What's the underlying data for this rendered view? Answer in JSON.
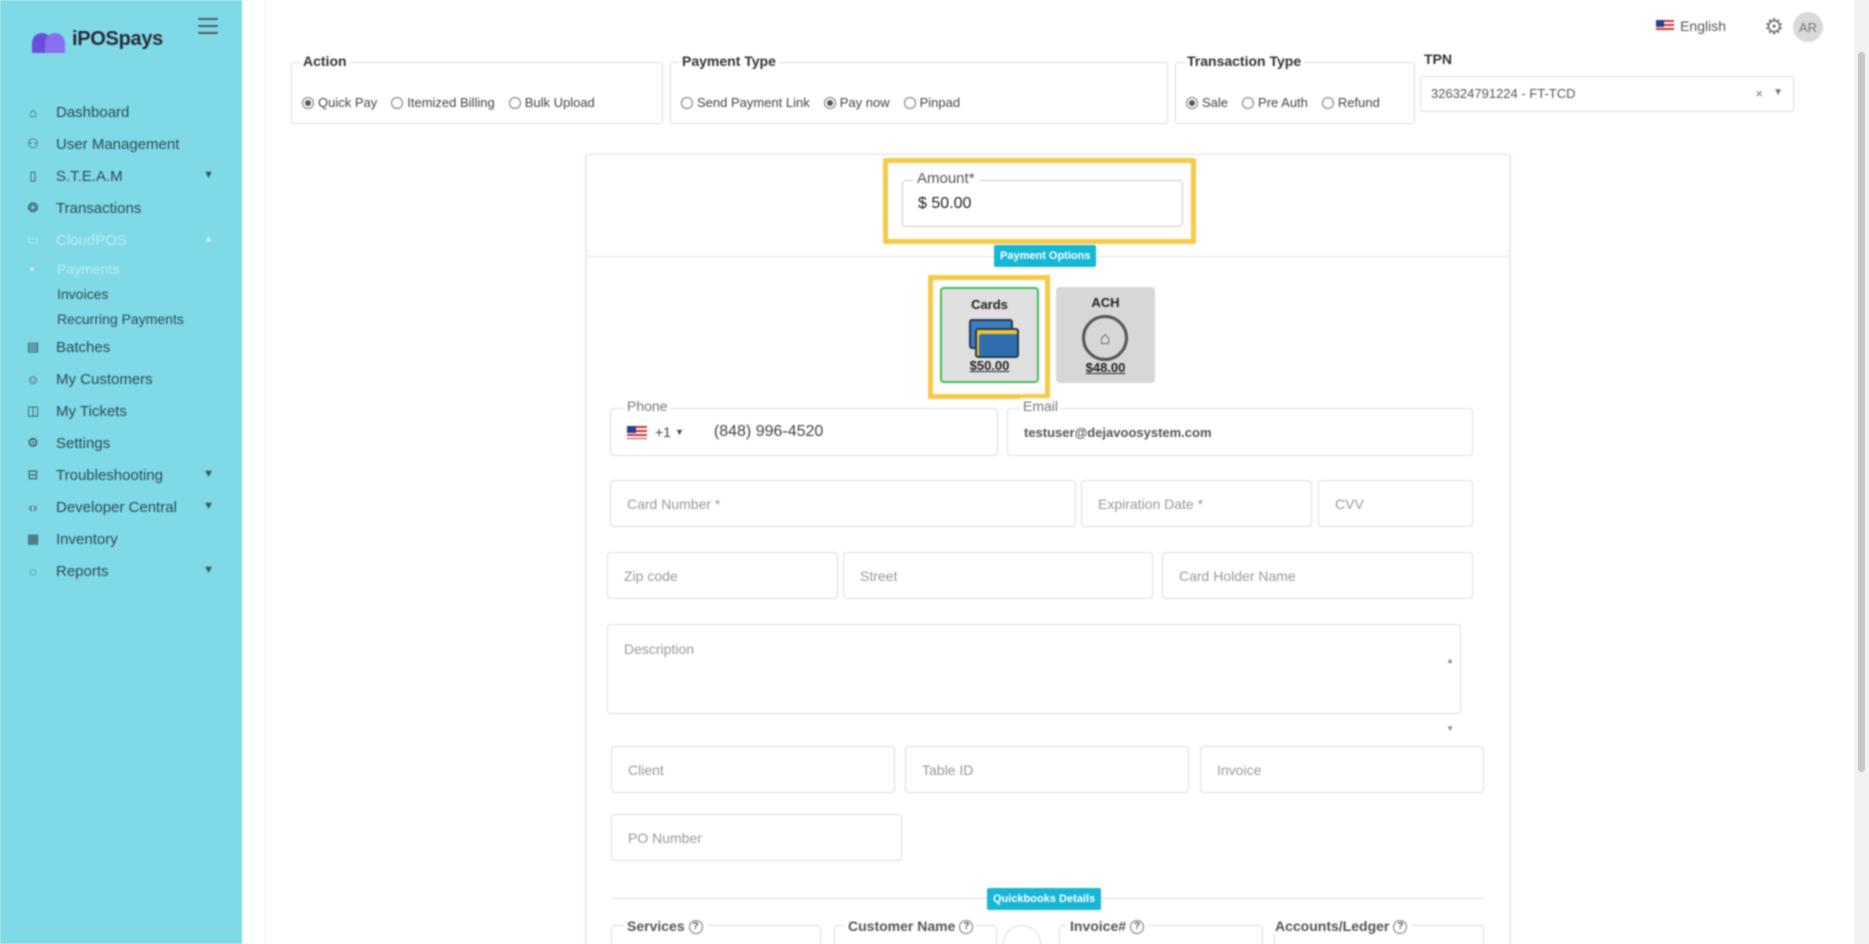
{
  "app": {
    "name": "iPOSpays"
  },
  "sidebar": {
    "items": [
      {
        "label": "Dashboard",
        "icon": "home-icon"
      },
      {
        "label": "User Management",
        "icon": "users-icon"
      },
      {
        "label": "S.T.E.A.M",
        "icon": "device-icon",
        "expandable": true
      },
      {
        "label": "Transactions",
        "icon": "dollar-icon"
      },
      {
        "label": "CloudPOS",
        "icon": "card-icon",
        "expanded": true
      },
      {
        "label": "Batches",
        "icon": "file-icon"
      },
      {
        "label": "My Customers",
        "icon": "person-icon"
      },
      {
        "label": "My Tickets",
        "icon": "ticket-icon"
      },
      {
        "label": "Settings",
        "icon": "gear-icon"
      },
      {
        "label": "Troubleshooting",
        "icon": "toolbox-icon",
        "expandable": true
      },
      {
        "label": "Developer Central",
        "icon": "code-icon",
        "expandable": true
      },
      {
        "label": "Inventory",
        "icon": "inventory-icon"
      },
      {
        "label": "Reports",
        "icon": "chat-icon",
        "expandable": true
      }
    ],
    "cloudpos_sub": [
      {
        "label": "Payments",
        "active": true
      },
      {
        "label": "Invoices"
      },
      {
        "label": "Recurring Payments"
      }
    ]
  },
  "header": {
    "language": "English",
    "avatar": "AR"
  },
  "action": {
    "title": "Action",
    "options": [
      "Quick Pay",
      "Itemized Billing",
      "Bulk Upload"
    ],
    "selected": "Quick Pay"
  },
  "payment_type": {
    "title": "Payment Type",
    "options": [
      "Send Payment Link",
      "Pay now",
      "Pinpad"
    ],
    "selected": "Pay now"
  },
  "transaction_type": {
    "title": "Transaction Type",
    "options": [
      "Sale",
      "Pre Auth",
      "Refund"
    ],
    "selected": "Sale"
  },
  "tpn": {
    "label": "TPN",
    "value": "326324791224 - FT-TCD"
  },
  "amount": {
    "label": "Amount*",
    "value": "$ 50.00"
  },
  "payment_options": {
    "badge": "Payment Options",
    "cards": {
      "label": "Cards",
      "amount": "$50.00"
    },
    "ach": {
      "label": "ACH",
      "amount": "$48.00"
    }
  },
  "form": {
    "phone_label": "Phone",
    "phone_code": "+1",
    "phone_value": "(848) 996-4520",
    "email_label": "Email",
    "email_value": "testuser@dejavoosystem.com",
    "card_number": "Card Number *",
    "expiration": "Expiration Date *",
    "cvv": "CVV",
    "zip": "Zip code",
    "street": "Street",
    "holder": "Card Holder Name",
    "description": "Description",
    "client": "Client",
    "table_id": "Table ID",
    "invoice": "Invoice",
    "po_number": "PO Number"
  },
  "quickbooks": {
    "badge": "Quickbooks Details",
    "services": "Services",
    "customer_name": "Customer Name",
    "invoice_no": "Invoice#",
    "accounts": "Accounts/Ledger"
  },
  "colors": {
    "sidebar": "#7fd9e6",
    "accent": "#16b7d4",
    "highlight": "#f7c948",
    "selected_border": "#3bbf5a"
  }
}
